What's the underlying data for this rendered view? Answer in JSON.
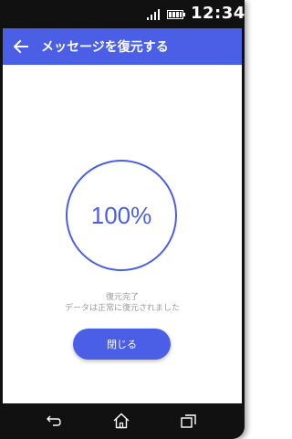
{
  "status_bar": {
    "time": "12:34",
    "icons": [
      "signal-icon",
      "battery-icon"
    ]
  },
  "app_bar": {
    "back_icon": "arrow-left-icon",
    "title": "メッセージを復元する"
  },
  "restore": {
    "progress_percent": 100,
    "progress_label": "100%",
    "status_title": "復元完了",
    "status_message": "データは正常に復元されました",
    "close_button_label": "閉じる"
  },
  "nav_bar": {
    "icons": [
      "back-icon",
      "home-icon",
      "recents-icon"
    ]
  },
  "colors": {
    "accent": "#4b5fe6",
    "frame": "#111111",
    "muted_text": "#9a9a9a"
  }
}
